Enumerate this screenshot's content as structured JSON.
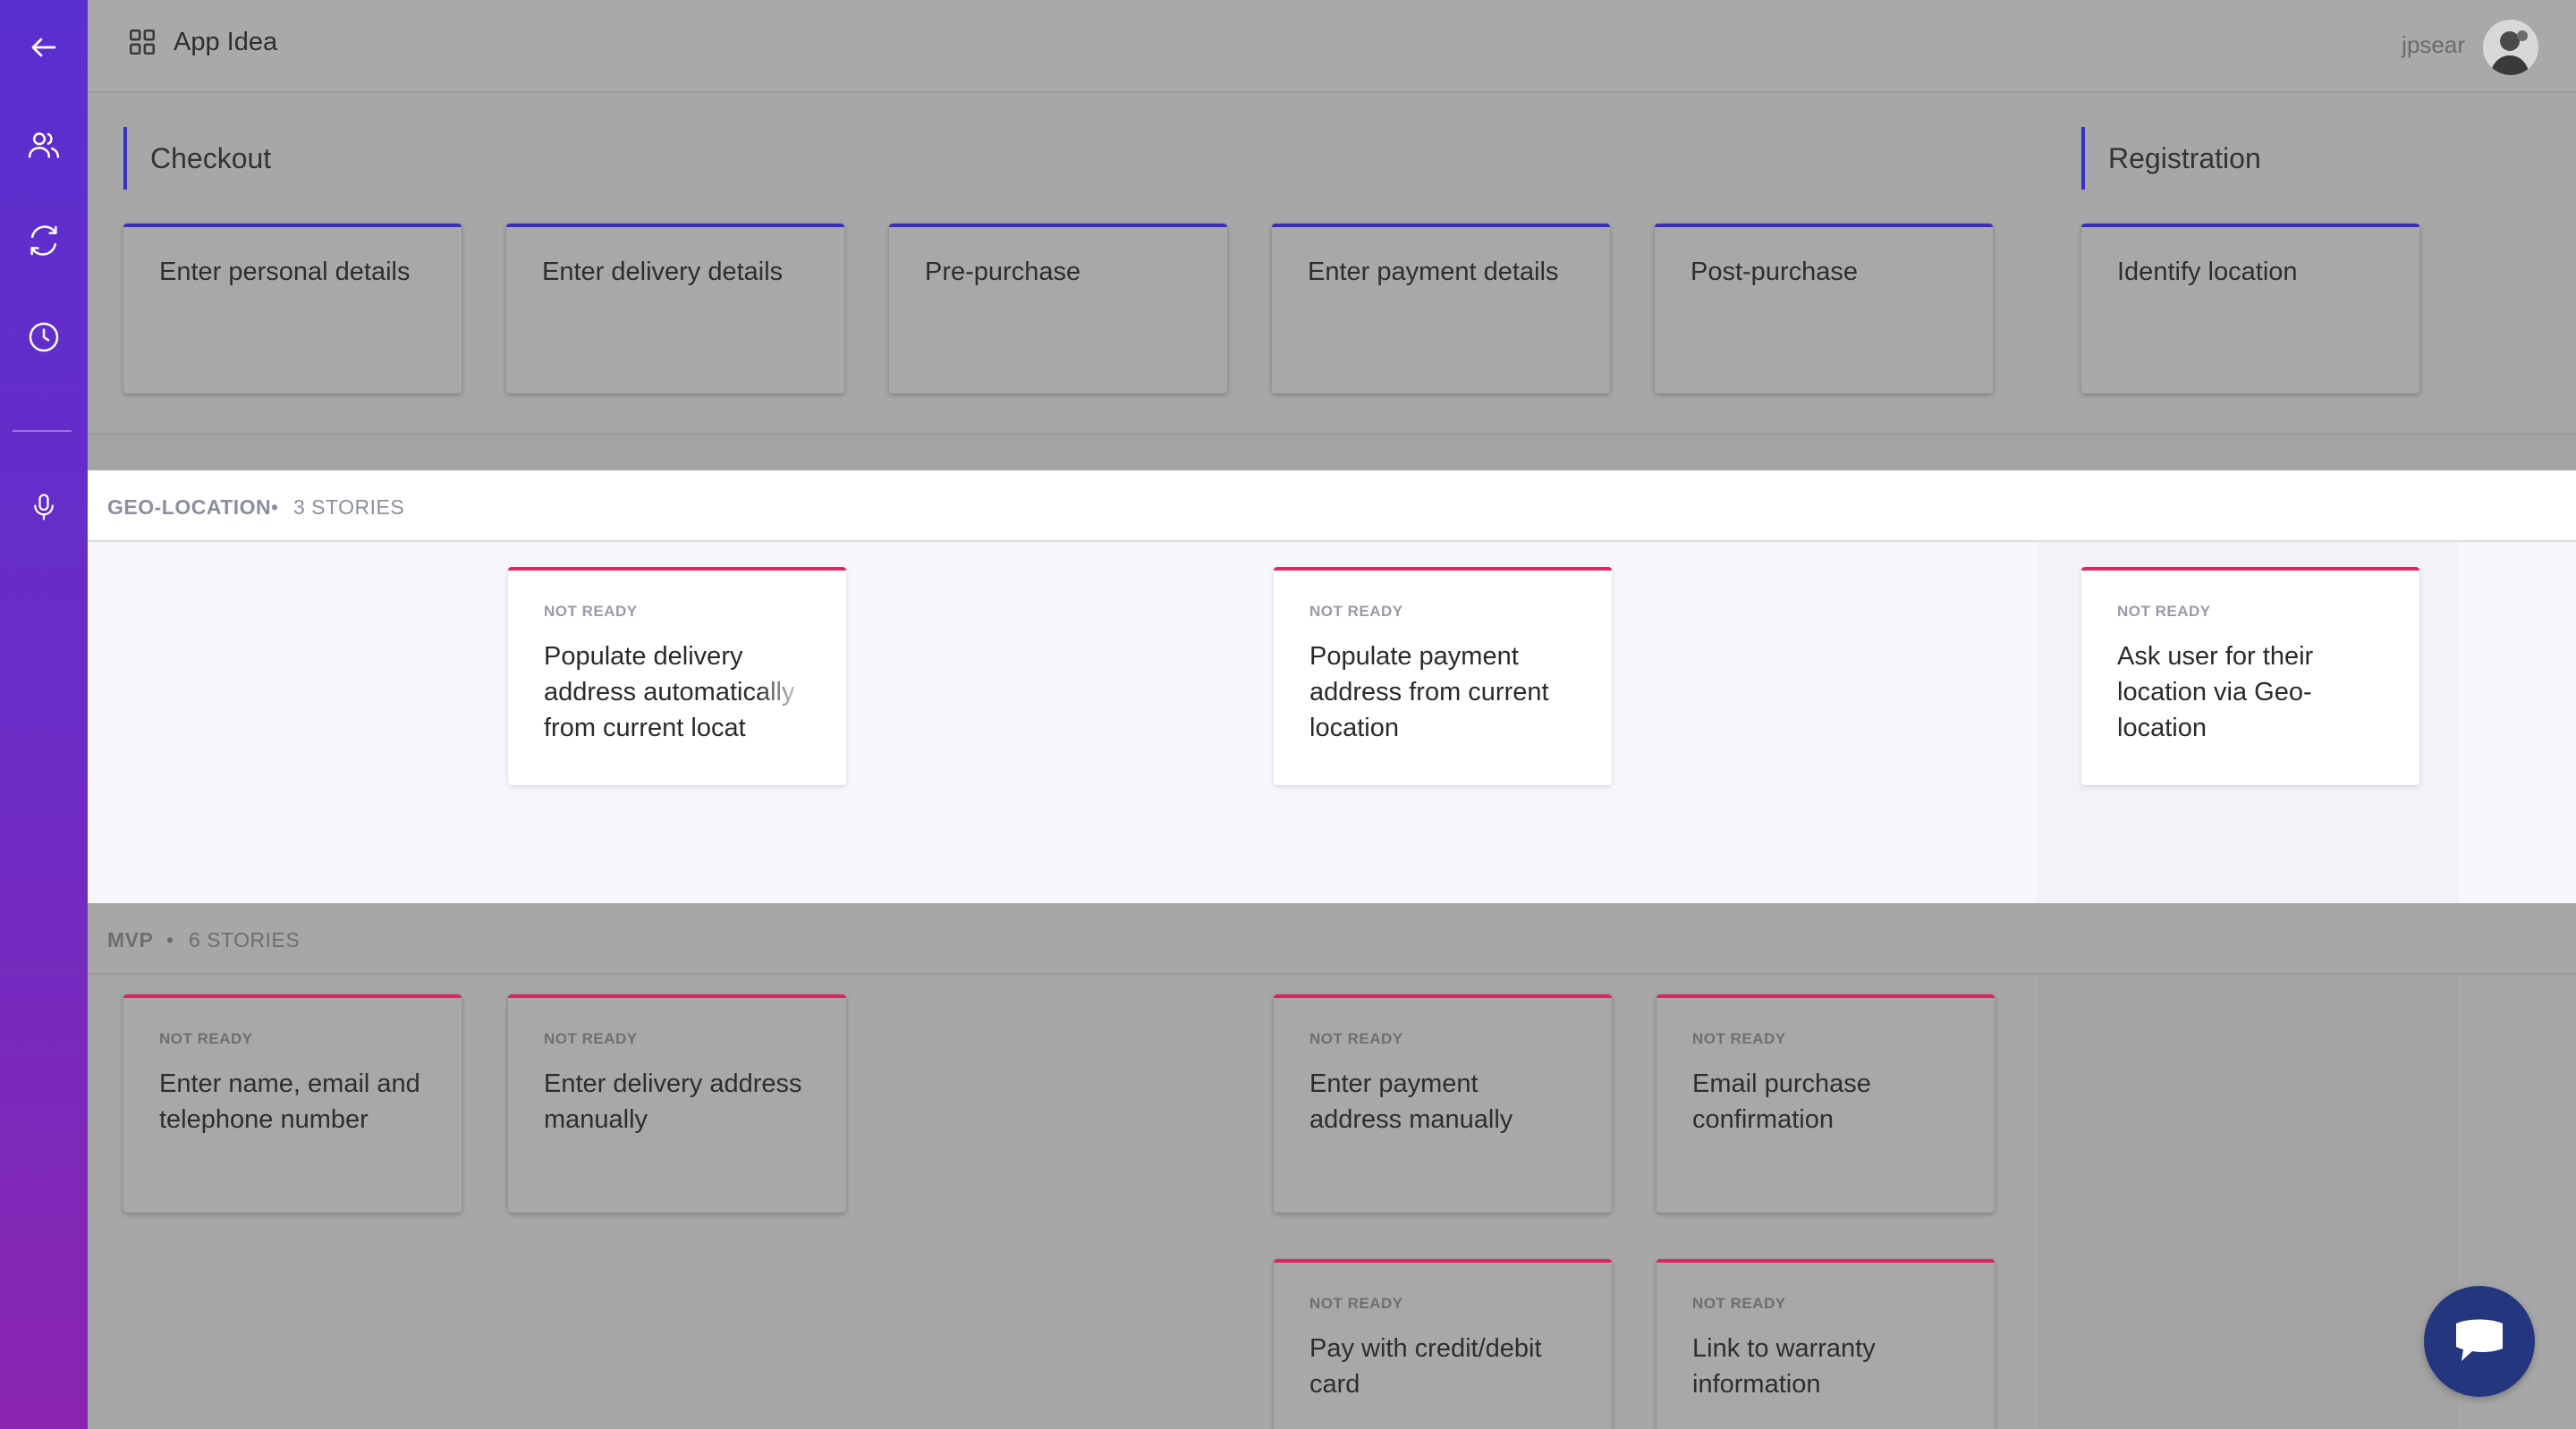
{
  "sidebar": {
    "items": [
      {
        "icon": "arrow-left-icon"
      },
      {
        "icon": "users-icon"
      },
      {
        "icon": "refresh-icon"
      },
      {
        "icon": "clock-icon"
      },
      {
        "icon": "microphone-icon"
      }
    ]
  },
  "header": {
    "app_icon": "grid-icon",
    "title": "App Idea",
    "username": "jpsear"
  },
  "activities": {
    "groups": [
      {
        "title": "Checkout"
      },
      {
        "title": "Registration"
      }
    ],
    "steps": [
      "Enter personal details",
      "Enter delivery details",
      "Pre-purchase",
      "Enter payment details",
      "Post-purchase",
      "Identify location"
    ]
  },
  "releases": {
    "geo": {
      "name": "GEO-LOCATION",
      "separator": "•",
      "count": "3 STORIES",
      "stories": [
        {
          "status": "NOT READY",
          "title": "Populate delivery address automatically from current locat"
        },
        {
          "status": "NOT READY",
          "title": "Populate payment address from current location"
        },
        {
          "status": "NOT READY",
          "title": "Ask user for their location via Geo-location"
        }
      ]
    },
    "mvp": {
      "name": "MVP",
      "separator": "•",
      "count": "6 STORIES",
      "stories": [
        {
          "status": "NOT READY",
          "title": "Enter name, email and telephone number"
        },
        {
          "status": "NOT READY",
          "title": "Enter delivery address manually"
        },
        {
          "status": "NOT READY",
          "title": "Enter payment address manually"
        },
        {
          "status": "NOT READY",
          "title": "Email purchase confirmation"
        },
        {
          "status": "NOT READY",
          "title": "Pay with credit/debit card"
        },
        {
          "status": "NOT READY",
          "title": "Link to warranty information"
        }
      ]
    }
  },
  "chat": {
    "icon": "chat-bubble-icon"
  },
  "colors": {
    "sidebar_top": "#5a2fd0",
    "sidebar_bottom": "#8a25b0",
    "activity_accent": "#3b2fb5",
    "story_accent": "#e0245e",
    "chat": "#24377e"
  }
}
